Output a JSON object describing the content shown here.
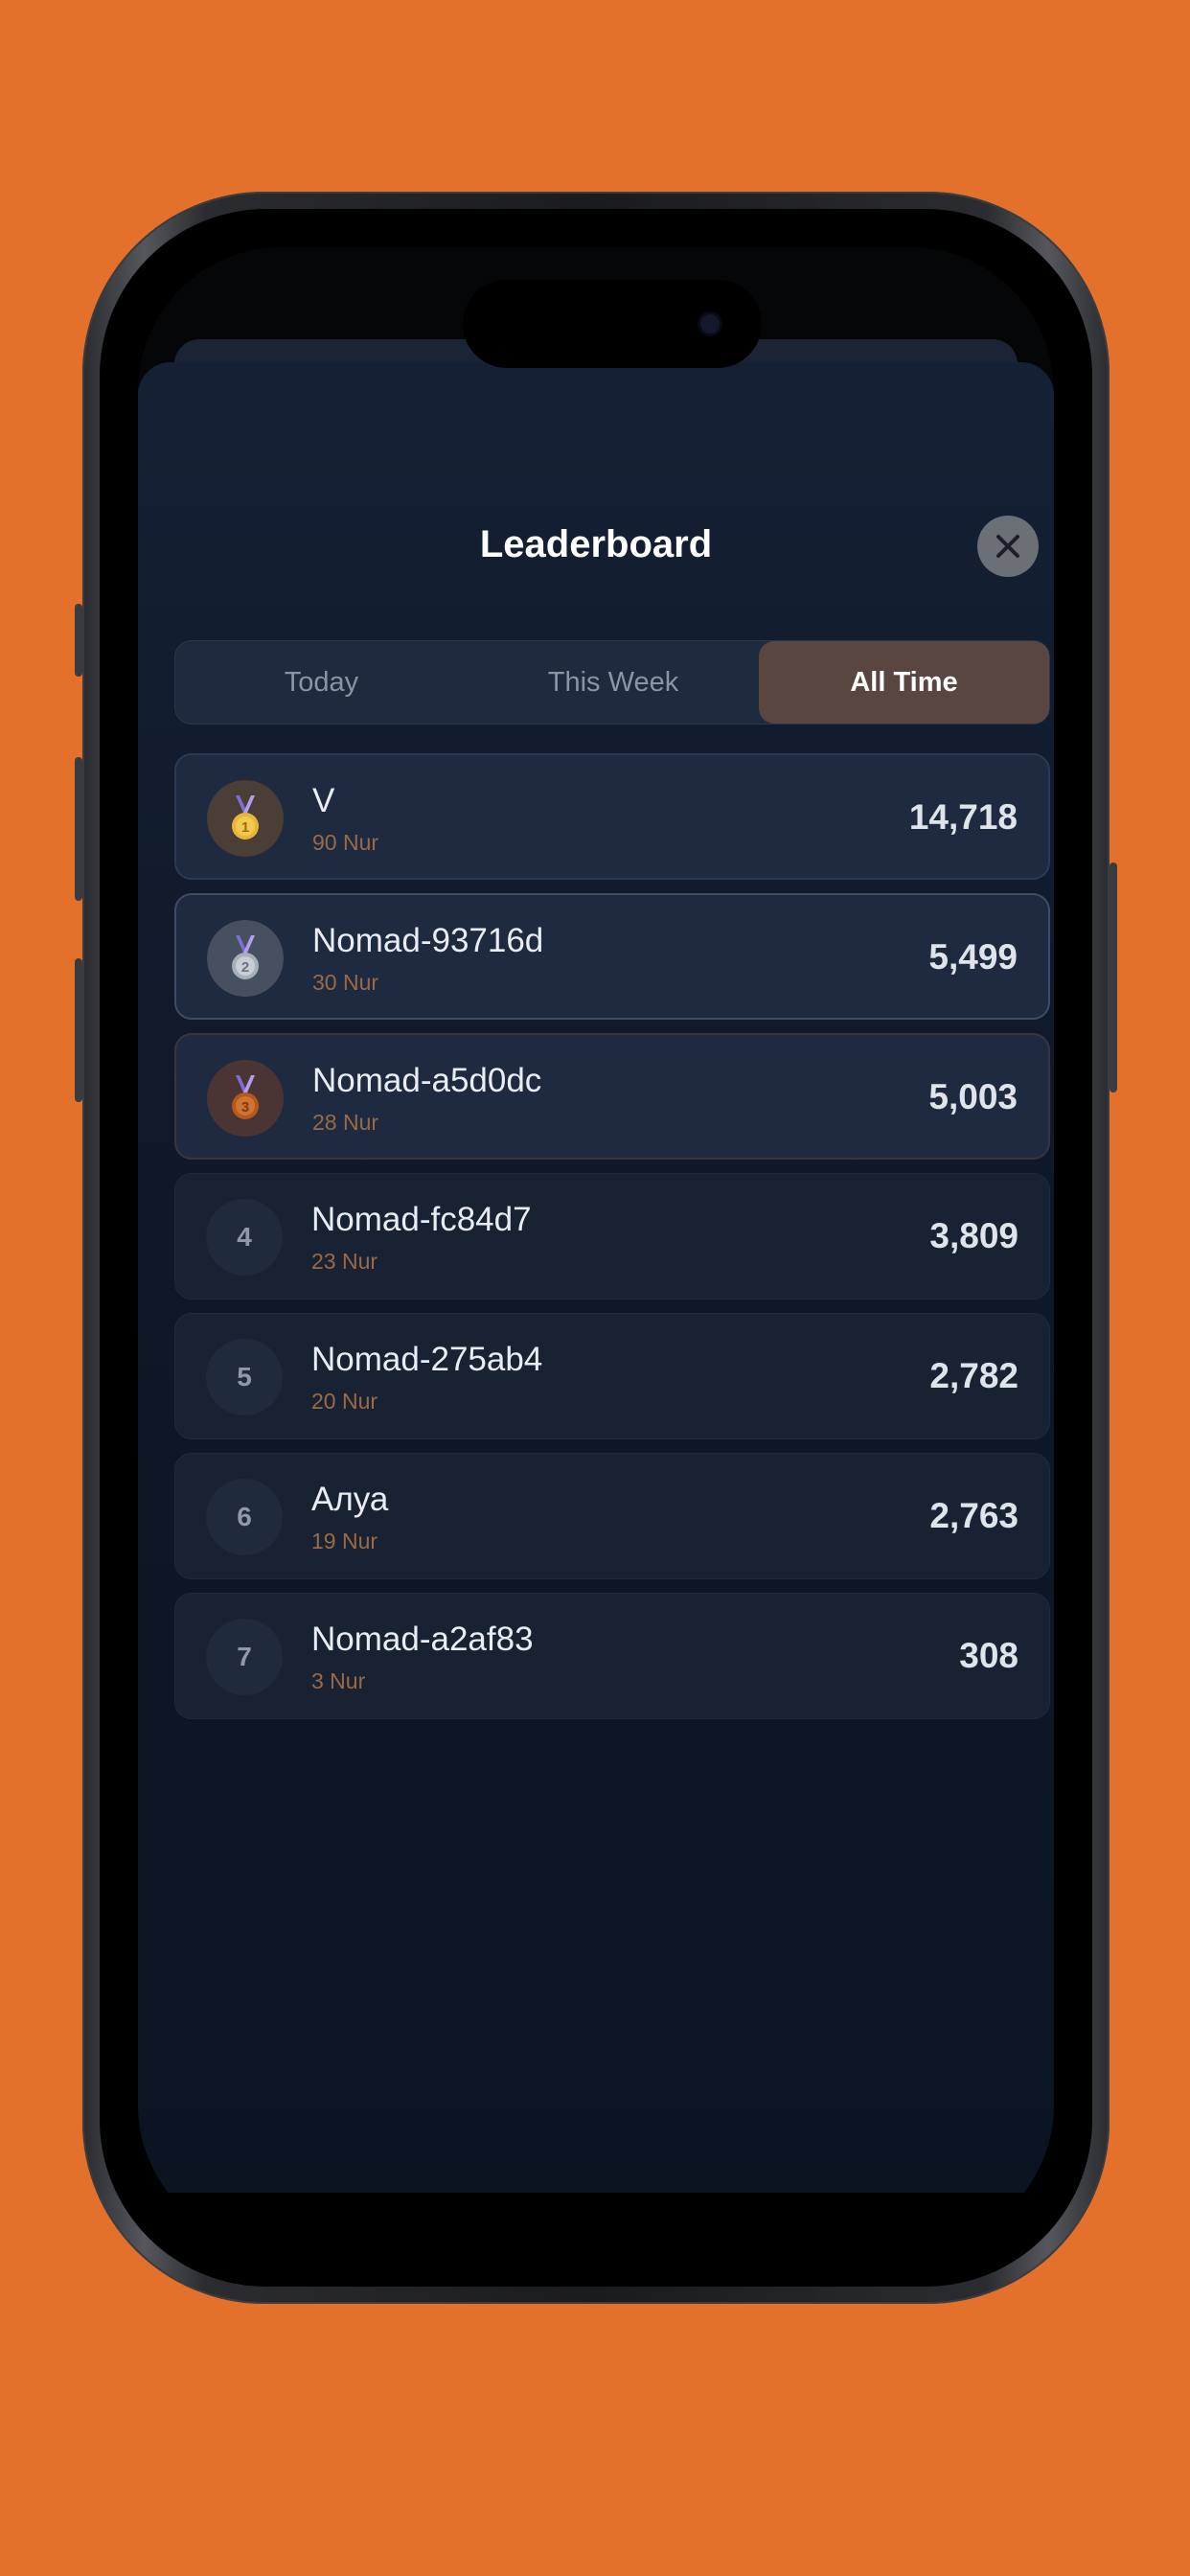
{
  "header": {
    "title": "Leaderboard"
  },
  "tabs": [
    {
      "label": "Today",
      "active": false
    },
    {
      "label": "This Week",
      "active": false
    },
    {
      "label": "All Time",
      "active": true
    }
  ],
  "entries": [
    {
      "rank": "1",
      "name": "V",
      "nur": "90 Nur",
      "score": "14,718",
      "medal": "gold-medal-icon"
    },
    {
      "rank": "2",
      "name": "Nomad-93716d",
      "nur": "30 Nur",
      "score": "5,499",
      "medal": "silver-medal-icon"
    },
    {
      "rank": "3",
      "name": "Nomad-a5d0dc",
      "nur": "28 Nur",
      "score": "5,003",
      "medal": "bronze-medal-icon"
    },
    {
      "rank": "4",
      "name": "Nomad-fc84d7",
      "nur": "23 Nur",
      "score": "3,809"
    },
    {
      "rank": "5",
      "name": "Nomad-275ab4",
      "nur": "20 Nur",
      "score": "2,782"
    },
    {
      "rank": "6",
      "name": "Алуа",
      "nur": "19 Nur",
      "score": "2,763"
    },
    {
      "rank": "7",
      "name": "Nomad-a2af83",
      "nur": "3 Nur",
      "score": "308"
    }
  ],
  "colors": {
    "background": "#E3712B",
    "sheet": "#0F1828",
    "active_tab": "#5A4640",
    "nur_text": "#9A6A46",
    "gold": "#E8B53A",
    "silver": "#BFC4CC",
    "bronze": "#C46A2E"
  }
}
